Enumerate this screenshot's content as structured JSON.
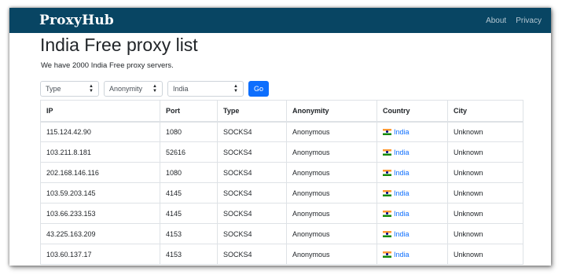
{
  "navbar": {
    "brand": "ProxyHub",
    "links": [
      "About",
      "Privacy"
    ]
  },
  "page": {
    "title": "India Free proxy list",
    "subtitle": "We have 2000 India Free proxy servers."
  },
  "filters": {
    "type": "Type",
    "anonymity": "Anonymity",
    "country": "India",
    "go_label": "Go"
  },
  "table": {
    "headers": [
      "IP",
      "Port",
      "Type",
      "Anonymity",
      "Country",
      "City"
    ],
    "rows": [
      {
        "ip": "115.124.42.90",
        "port": "1080",
        "type": "SOCKS4",
        "anonymity": "Anonymous",
        "country": "India",
        "city": "Unknown"
      },
      {
        "ip": "103.211.8.181",
        "port": "52616",
        "type": "SOCKS4",
        "anonymity": "Anonymous",
        "country": "India",
        "city": "Unknown"
      },
      {
        "ip": "202.168.146.116",
        "port": "1080",
        "type": "SOCKS4",
        "anonymity": "Anonymous",
        "country": "India",
        "city": "Unknown"
      },
      {
        "ip": "103.59.203.145",
        "port": "4145",
        "type": "SOCKS4",
        "anonymity": "Anonymous",
        "country": "India",
        "city": "Unknown"
      },
      {
        "ip": "103.66.233.153",
        "port": "4145",
        "type": "SOCKS4",
        "anonymity": "Anonymous",
        "country": "India",
        "city": "Unknown"
      },
      {
        "ip": "43.225.163.209",
        "port": "4153",
        "type": "SOCKS4",
        "anonymity": "Anonymous",
        "country": "India",
        "city": "Unknown"
      },
      {
        "ip": "103.60.137.17",
        "port": "4153",
        "type": "SOCKS4",
        "anonymity": "Anonymous",
        "country": "India",
        "city": "Unknown"
      }
    ]
  },
  "icons": {
    "flag": "india-flag-icon",
    "caret": "chevron-updown-icon"
  },
  "colors": {
    "navbar_bg": "#084563",
    "link": "#0d6efd",
    "button": "#0d6efd"
  }
}
